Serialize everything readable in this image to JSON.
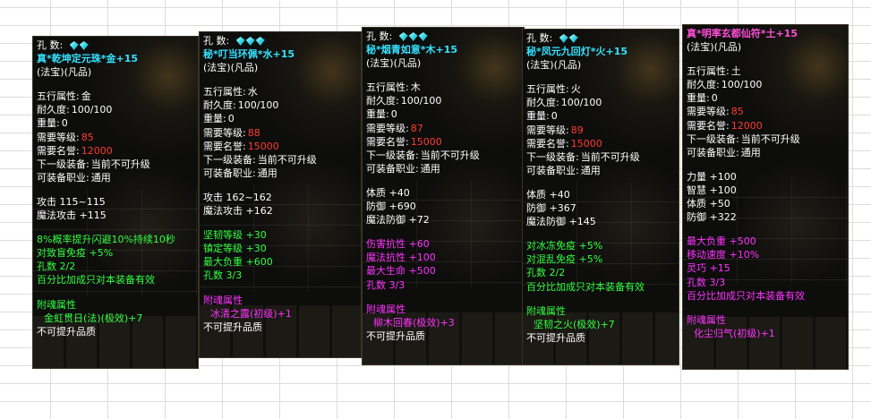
{
  "tooltips": [
    {
      "holes_label": "孔      数:",
      "name": "真*乾坤定元珠*金+15",
      "subtitle": "(法宝)(凡品)",
      "element_label": "五行属性:",
      "element": "金",
      "durability_label": "耐久度:",
      "durability": "100/100",
      "weight_label": "重量:",
      "weight": "0",
      "level_label": "需要等级:",
      "level": "85",
      "fame_label": "需要名誉:",
      "fame": "12000",
      "next_label": "下一级装备:",
      "next": "当前不可升级",
      "job_label": "可装备职业:",
      "job": "通用",
      "stats": [
        "攻击 115~115",
        "魔法攻击 +115"
      ],
      "green": [
        "8%概率提升闪避10%持续10秒",
        "对致盲免疫 +5%",
        "孔数 2/2",
        "百分比加成只对本装备有效"
      ],
      "soul_label": "附魂属性",
      "soul": "金虹贯日(法)(极效)+7",
      "footer": "不可提升品质"
    },
    {
      "holes_label": "孔      数:",
      "name": "秘*叮当环佩*水+15",
      "subtitle": "(法宝)(凡品)",
      "element_label": "五行属性:",
      "element": "水",
      "durability_label": "耐久度:",
      "durability": "100/100",
      "weight_label": "重量:",
      "weight": "0",
      "level_label": "需要等级:",
      "level": "88",
      "fame_label": "需要名誉:",
      "fame": "15000",
      "next_label": "下一级装备:",
      "next": "当前不可升级",
      "job_label": "可装备职业:",
      "job": "通用",
      "stats": [
        "攻击 162~162",
        "魔法攻击 +162"
      ],
      "green": [
        "坚韧等级 +30",
        "镇定等级 +30",
        "最大负重 +600",
        "孔数 3/3"
      ],
      "soul_label": "附魂属性",
      "soul": "冰清之露(初级)+1",
      "footer": "不可提升品质"
    },
    {
      "holes_label": "孔      数:",
      "name": "秘*烟青如意*木+15",
      "subtitle": "(法宝)(凡品)",
      "element_label": "五行属性:",
      "element": "木",
      "durability_label": "耐久度:",
      "durability": "100/100",
      "weight_label": "重量:",
      "weight": "0",
      "level_label": "需要等级:",
      "level": "87",
      "fame_label": "需要名誉:",
      "fame": "15000",
      "next_label": "下一级装备:",
      "next": "当前不可升级",
      "job_label": "可装备职业:",
      "job": "通用",
      "stats": [
        "体质 +40",
        "防御 +690",
        "魔法防御 +72"
      ],
      "green": [
        "伤害抗性 +60",
        "魔法抗性 +100",
        "最大生命 +500",
        "孔数 3/3"
      ],
      "soul_label": "附魂属性",
      "soul": "柳木回春(极效)+3",
      "footer": "不可提升品质"
    },
    {
      "holes_label": "孔      数:",
      "name": "秘*凤元九回灯*火+15",
      "subtitle": "(法宝)(凡品)",
      "element_label": "五行属性:",
      "element": "火",
      "durability_label": "耐久度:",
      "durability": "100/100",
      "weight_label": "重量:",
      "weight": "0",
      "level_label": "需要等级:",
      "level": "89",
      "fame_label": "需要名誉:",
      "fame": "15000",
      "next_label": "下一级装备:",
      "next": "当前不可升级",
      "job_label": "可装备职业:",
      "job": "通用",
      "stats": [
        "体质 +40",
        "防御 +367",
        "魔法防御 +145"
      ],
      "green": [
        "对冰冻免疫 +5%",
        "对混乱免疫 +5%",
        "孔数 2/2",
        "百分比加成只对本装备有效"
      ],
      "soul_label": "附魂属性",
      "soul": "坚韧之火(极效)+7",
      "footer": "不可提升品质"
    },
    {
      "name": "真*明率玄都仙符*土+15",
      "subtitle": "(法宝)(凡品)",
      "element_label": "五行属性:",
      "element": "土",
      "durability_label": "耐久度:",
      "durability": "100/100",
      "weight_label": "重量:",
      "weight": "0",
      "level_label": "需要等级:",
      "level": "85",
      "fame_label": "需要名誉:",
      "fame": "12000",
      "next_label": "下一级装备:",
      "next": "当前不可升级",
      "job_label": "可装备职业:",
      "job": "通用",
      "stats": [
        "力量 +100",
        "智慧 +100",
        "体质 +50",
        "防御 +322"
      ],
      "green": [
        "最大负重 +500",
        "移动速度 +10%",
        "灵巧 +15",
        "孔数 3/3",
        "百分比加成只对本装备有效"
      ],
      "soul_label": "附魂属性",
      "soul": "化尘归气(初级)+1",
      "footer": ""
    }
  ],
  "colors": {
    "name_cyan": "#34e3ff",
    "name_pink": "#ff4fd6",
    "requirement_red": "#ff3b2f",
    "bonus_green": "#33ff40",
    "soul_magenta": "#ff33ff"
  },
  "icons": [
    "diamond-gem-icon"
  ]
}
